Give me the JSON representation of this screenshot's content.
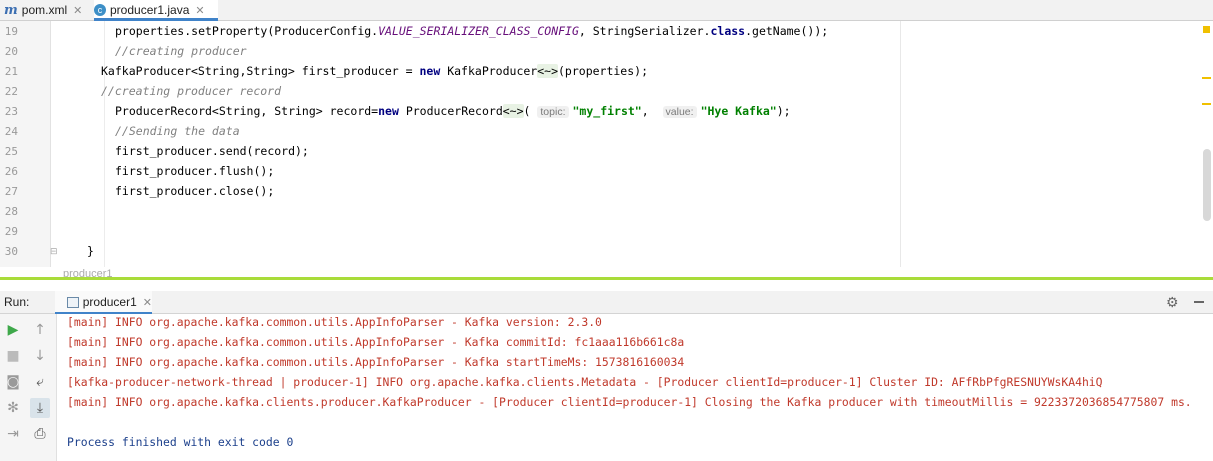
{
  "tabs": [
    {
      "icon": "maven-icon",
      "icon_glyph": "m",
      "label": "pom.xml"
    },
    {
      "icon": "java-class-icon",
      "icon_glyph": "c",
      "label": "producer1.java"
    }
  ],
  "editor": {
    "line_numbers": [
      "19",
      "20",
      "21",
      "22",
      "23",
      "24",
      "25",
      "26",
      "27",
      "28",
      "29",
      "30"
    ],
    "lines": {
      "l19_a": "properties.setProperty(ProducerConfig.",
      "l19_const": "VALUE_SERIALIZER_CLASS_CONFIG",
      "l19_b": ", StringSerializer.",
      "l19_kw": "class",
      "l19_c": ".getName());",
      "l20": "//creating producer",
      "l21_a": "KafkaProducer<String,String> first_producer = ",
      "l21_kw": "new",
      "l21_b": " KafkaProducer",
      "l21_diam": "<~>",
      "l21_c": "(properties);",
      "l22": "//creating producer record",
      "l23_a": "ProducerRecord<String, String> record=",
      "l23_kw": "new",
      "l23_b": " ProducerRecord",
      "l23_diam": "<~>",
      "l23_c": "( ",
      "l23_hint1": "topic:",
      "l23_str1": "\"my_first\"",
      "l23_d": ",  ",
      "l23_hint2": "value:",
      "l23_str2": "\"Hye Kafka\"",
      "l23_e": ");",
      "l24": "//Sending the data",
      "l25": "first_producer.send(record);",
      "l26": "first_producer.flush();",
      "l27": "first_producer.close();",
      "l30": "}"
    },
    "breadcrumb": "producer1"
  },
  "run_panel": {
    "label": "Run:",
    "tab_label": "producer1",
    "console_lines": [
      "[main] INFO org.apache.kafka.common.utils.AppInfoParser - Kafka version: 2.3.0",
      "[main] INFO org.apache.kafka.common.utils.AppInfoParser - Kafka commitId: fc1aaa116b661c8a",
      "[main] INFO org.apache.kafka.common.utils.AppInfoParser - Kafka startTimeMs: 1573816160034",
      "[kafka-producer-network-thread | producer-1] INFO org.apache.kafka.clients.Metadata - [Producer clientId=producer-1] Cluster ID: AFfRbPfgRESNUYWsKA4hiQ",
      "[main] INFO org.apache.kafka.clients.producer.KafkaProducer - [Producer clientId=producer-1] Closing the Kafka producer with timeoutMillis = 9223372036854775807 ms.",
      "Process finished with exit code 0"
    ]
  },
  "colors": {
    "divider": "#a9dc3a",
    "error_text": "#c0392b",
    "finished_text": "#1b3f8b"
  }
}
